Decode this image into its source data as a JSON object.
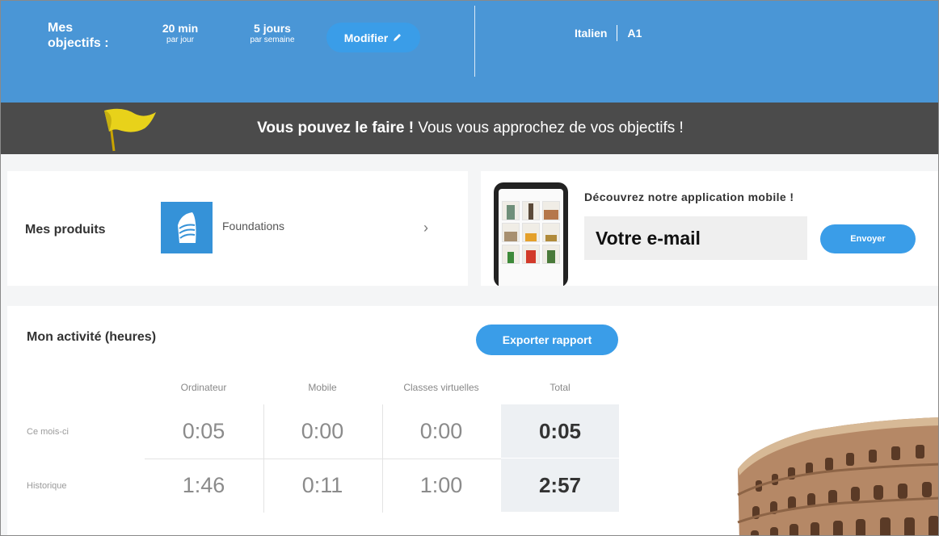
{
  "header": {
    "goals_label": "Mes objectifs :",
    "minutes_value": "20 min",
    "minutes_unit": "par jour",
    "days_value": "5 jours",
    "days_unit": "par semaine",
    "modify_label": "Modifier",
    "language": "Italien",
    "level": "A1"
  },
  "banner": {
    "bold": "Vous pouvez le faire !",
    "text": " Vous vous approchez de vos objectifs !"
  },
  "products": {
    "title": "Mes produits",
    "item_name": "Foundations"
  },
  "app_promo": {
    "title": "Découvrez notre application mobile !",
    "email_placeholder": "Votre e-mail",
    "send_label": "Envoyer"
  },
  "activity": {
    "title": "Mon activité (heures)",
    "export_label": "Exporter rapport",
    "columns": [
      "Ordinateur",
      "Mobile",
      "Classes virtuelles",
      "Total"
    ],
    "rows": [
      {
        "label": "Ce mois-ci",
        "values": [
          "0:05",
          "0:00",
          "0:00",
          "0:05"
        ]
      },
      {
        "label": "Historique",
        "values": [
          "1:46",
          "0:11",
          "1:00",
          "2:57"
        ]
      }
    ]
  },
  "colors": {
    "header_blue": "#4a96d6",
    "button_blue": "#3a9de8",
    "banner_gray": "#4b4b4b"
  }
}
